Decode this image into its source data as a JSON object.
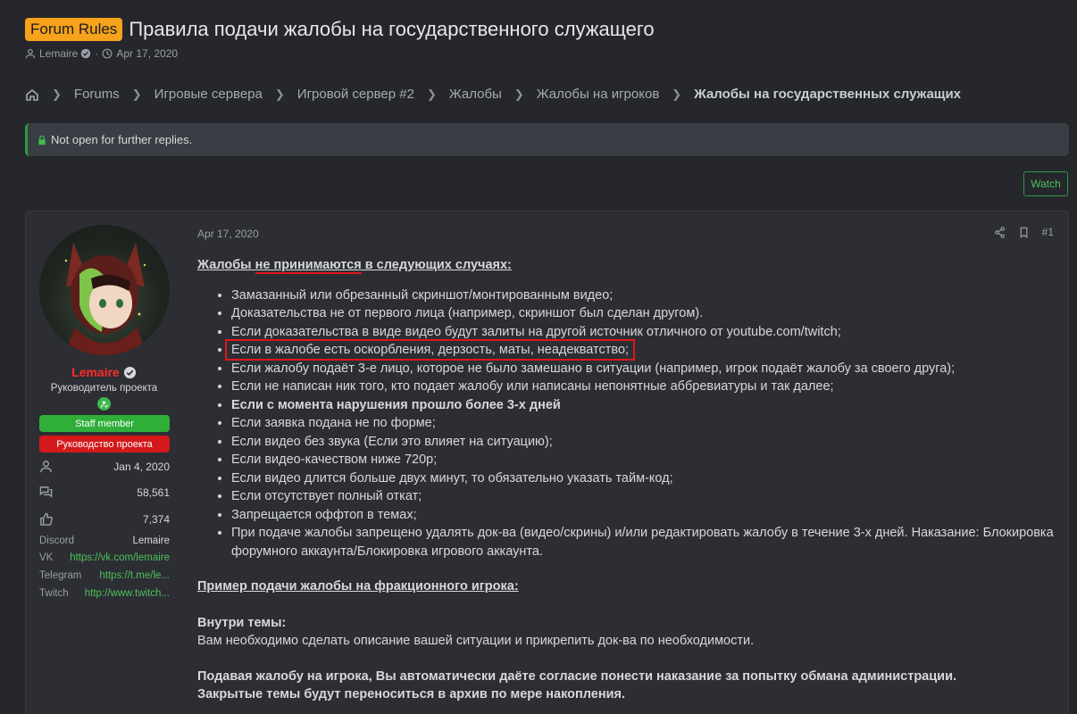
{
  "thread": {
    "prefix": "Forum Rules",
    "title": "Правила подачи жалобы на государственного служащего",
    "author": "Lemaire",
    "date": "Apr 17, 2020"
  },
  "breadcrumb": {
    "items": [
      "Forums",
      "Игровые сервера",
      "Игровой сервер #2",
      "Жалобы",
      "Жалобы на игроков"
    ],
    "current": "Жалобы на государственных служащих"
  },
  "notice": {
    "text": "Not open for further replies."
  },
  "watch_label": "Watch",
  "user": {
    "name": "Lemaire",
    "title": "Руководитель проекта",
    "banners": [
      "Staff member",
      "Руководство проекта"
    ],
    "joined": "Jan 4, 2020",
    "messages": "58,561",
    "reactions": "7,374",
    "fields": [
      {
        "key": "Discord",
        "value": "Lemaire"
      },
      {
        "key": "VK",
        "value": "https://vk.com/lemaire"
      },
      {
        "key": "Telegram",
        "value": "https://t.me/le..."
      },
      {
        "key": "Twitch",
        "value": "http://www.twitch..."
      }
    ]
  },
  "post": {
    "date": "Apr 17, 2020",
    "number": "#1",
    "heading_pre": "Жалобы ",
    "heading_mid": "не принимаются",
    "heading_post": " в следующих случаях:",
    "items": [
      "Замазанный или обрезанный скриншот/монтированным видео;",
      "Доказательства не от первого лица (например, скриншот был сделан другом).",
      "Если доказательства в виде видео будут залиты на другой источник отличного от youtube.com/twitch;",
      "Если в жалобе есть оскорбления, дерзость, маты, неадекватство;",
      "Если жалобу подаёт 3-е лицо, которое не было замешано в ситуации (например, игрок подаёт жалобу за своего друга);",
      "Если не написан ник того, кто подает жалобу или написаны непонятные аббревиатуры и так далее;",
      "Если с момента нарушения прошло более 3-х дней",
      "Если заявка подана не по форме;",
      "Если видео без звука (Если это влияет на ситуацию);",
      "Если видео-качеством ниже 720p;",
      "Если видео длится больше двух минут, то обязательно указать тайм-код;",
      "Если отсутствует полный откат;",
      "Запрещается оффтоп в темах;",
      "При подаче жалобы запрещено удалять док-ва (видео/скрины) и/или редактировать жалобу в течение 3-х дней. Наказание: Блокировка форумного аккаунта/Блокировка игрового аккаунта."
    ],
    "example_heading": "Пример подачи жалобы на фракционного игрока:",
    "inside_label": "Внутри темы:",
    "inside_text": "Вам необходимо сделать описание вашей ситуации и прикрепить док-ва по необходимости.",
    "consent_text": "Подавая жалобу на игрока, Вы автоматически даёте согласие понести наказание за попытку обмана администрации.",
    "archive_text": "Закрытые темы будут переноситься в архив по мере накопления."
  },
  "colors": {
    "background": "#25272c",
    "prefix_badge": "#f6a21b",
    "username": "#ff2a2a",
    "staff_banner": "#2fae3a",
    "lead_banner": "#d3191b",
    "link": "#4cc05c",
    "highlight_box": "#e0161b"
  }
}
